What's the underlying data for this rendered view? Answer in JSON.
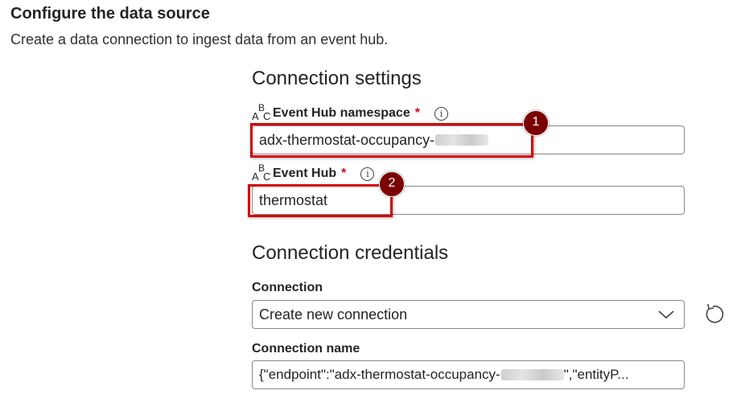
{
  "header": {
    "title": "Configure the data source",
    "subtitle": "Create a data connection to ingest data from an event hub."
  },
  "connection_settings": {
    "title": "Connection settings",
    "namespace": {
      "label": "Event Hub namespace",
      "required_marker": "*",
      "value_prefix": "adx-thermostat-occupancy-"
    },
    "event_hub": {
      "label": "Event Hub",
      "required_marker": "*",
      "value": "thermostat"
    }
  },
  "connection_credentials": {
    "title": "Connection credentials",
    "connection": {
      "label": "Connection",
      "selected": "Create new connection"
    },
    "connection_name": {
      "label": "Connection name",
      "value_prefix": "{\"endpoint\":\"adx-thermostat-occupancy-",
      "value_suffix": "\",\"entityP..."
    }
  },
  "callouts": [
    "1",
    "2"
  ],
  "icons": {
    "type": "abc-icon",
    "info": "info-icon",
    "dropdown": "chevron-down-icon",
    "refresh": "refresh-icon"
  },
  "colors": {
    "highlight": "#d40000",
    "badge": "#7a0000",
    "required": "#c50f1f"
  }
}
